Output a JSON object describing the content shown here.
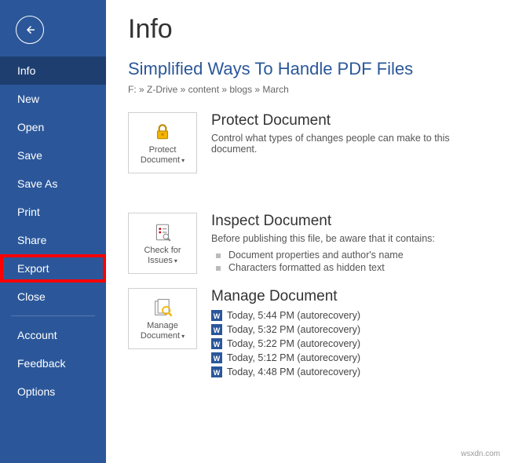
{
  "sidebar": {
    "items": [
      {
        "label": "Info",
        "selected": true
      },
      {
        "label": "New"
      },
      {
        "label": "Open"
      },
      {
        "label": "Save"
      },
      {
        "label": "Save As"
      },
      {
        "label": "Print"
      },
      {
        "label": "Share"
      },
      {
        "label": "Export",
        "highlight": true
      },
      {
        "label": "Close"
      }
    ],
    "footer": [
      {
        "label": "Account"
      },
      {
        "label": "Feedback"
      },
      {
        "label": "Options"
      }
    ]
  },
  "page": {
    "title": "Info",
    "doc_title": "Simplified Ways To Handle PDF Files",
    "breadcrumb": "F: » Z-Drive » content » blogs » March"
  },
  "protect": {
    "tile_label": "Protect Document",
    "heading": "Protect Document",
    "text": "Control what types of changes people can make to this document."
  },
  "inspect": {
    "tile_label": "Check for Issues",
    "heading": "Inspect Document",
    "text": "Before publishing this file, be aware that it contains:",
    "bullets": [
      "Document properties and author's name",
      "Characters formatted as hidden text"
    ]
  },
  "manage": {
    "tile_label": "Manage Document",
    "heading": "Manage Document",
    "versions": [
      "Today, 5:44 PM (autorecovery)",
      "Today, 5:32 PM (autorecovery)",
      "Today, 5:22 PM (autorecovery)",
      "Today, 5:12 PM (autorecovery)",
      "Today, 4:48 PM (autorecovery)"
    ]
  },
  "watermark": "wsxdn.com"
}
